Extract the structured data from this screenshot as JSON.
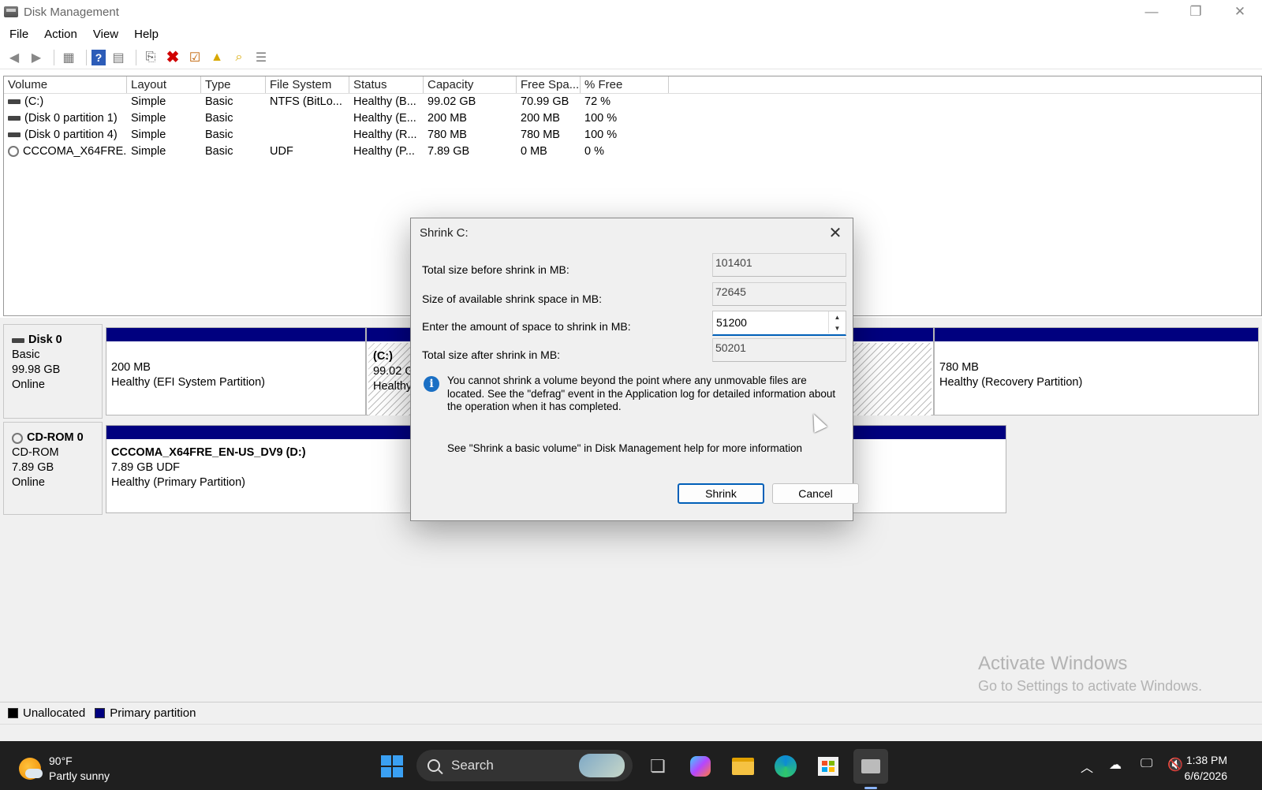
{
  "window": {
    "title": "Disk Management",
    "minimize": "—",
    "restore": "❐",
    "close": "✕"
  },
  "menu": [
    "File",
    "Action",
    "View",
    "Help"
  ],
  "volume_list": {
    "headers": [
      "Volume",
      "Layout",
      "Type",
      "File System",
      "Status",
      "Capacity",
      "Free Spa...",
      "% Free"
    ],
    "rows": [
      {
        "volume": "(C:)",
        "layout": "Simple",
        "type": "Basic",
        "fs": "NTFS (BitLo...",
        "status": "Healthy (B...",
        "capacity": "99.02 GB",
        "free": "70.99 GB",
        "pct": "72 %",
        "icon": "drive-icon"
      },
      {
        "volume": "(Disk 0 partition 1)",
        "layout": "Simple",
        "type": "Basic",
        "fs": "",
        "status": "Healthy (E...",
        "capacity": "200 MB",
        "free": "200 MB",
        "pct": "100 %",
        "icon": "drive-icon"
      },
      {
        "volume": "(Disk 0 partition 4)",
        "layout": "Simple",
        "type": "Basic",
        "fs": "",
        "status": "Healthy (R...",
        "capacity": "780 MB",
        "free": "780 MB",
        "pct": "100 %",
        "icon": "drive-icon"
      },
      {
        "volume": "CCCOMA_X64FRE...",
        "layout": "Simple",
        "type": "Basic",
        "fs": "UDF",
        "status": "Healthy (P...",
        "capacity": "7.89 GB",
        "free": "0 MB",
        "pct": "0 %",
        "icon": "cd-icon"
      }
    ]
  },
  "disks": {
    "disk0": {
      "name": "Disk 0",
      "type": "Basic",
      "size": "99.98 GB",
      "state": "Online",
      "p1": {
        "size": "200 MB",
        "status": "Healthy (EFI System Partition)"
      },
      "p2": {
        "name": "(C:)",
        "size": "99.02 G",
        "status": "Healthy"
      },
      "p4": {
        "size": "780 MB",
        "status": "Healthy (Recovery Partition)"
      }
    },
    "cdrom0": {
      "name": "CD-ROM 0",
      "type": "CD-ROM",
      "size": "7.89 GB",
      "state": "Online",
      "p1": {
        "name": "CCCOMA_X64FRE_EN-US_DV9  (D:)",
        "size": "7.89 GB UDF",
        "status": "Healthy (Primary Partition)"
      }
    }
  },
  "legend": {
    "unallocated": "Unallocated",
    "primary": "Primary partition",
    "unallocated_color": "#000000",
    "primary_color": "#00007f"
  },
  "watermark": {
    "line1": "Activate Windows",
    "line2": "Go to Settings to activate Windows."
  },
  "dialog": {
    "title": "Shrink C:",
    "close": "✕",
    "total_before_label": "Total size before shrink in MB:",
    "total_before_value": "101401",
    "available_label": "Size of available shrink space in MB:",
    "available_value": "72645",
    "amount_label": "Enter the amount of space to shrink in MB:",
    "amount_value": "51200",
    "total_after_label": "Total size after shrink in MB:",
    "total_after_value": "50201",
    "info": "You cannot shrink a volume beyond the point where any unmovable files are located. See the \"defrag\" event in the Application log for detailed information about the operation when it has completed.",
    "help": "See \"Shrink a basic volume\" in Disk Management help for more information",
    "shrink_button": "Shrink",
    "cancel_button": "Cancel"
  },
  "taskbar": {
    "weather_temp": "90°F",
    "weather_desc": "Partly sunny",
    "search_placeholder": "Search",
    "time": "1:38 PM",
    "date": "6/6/2026"
  }
}
